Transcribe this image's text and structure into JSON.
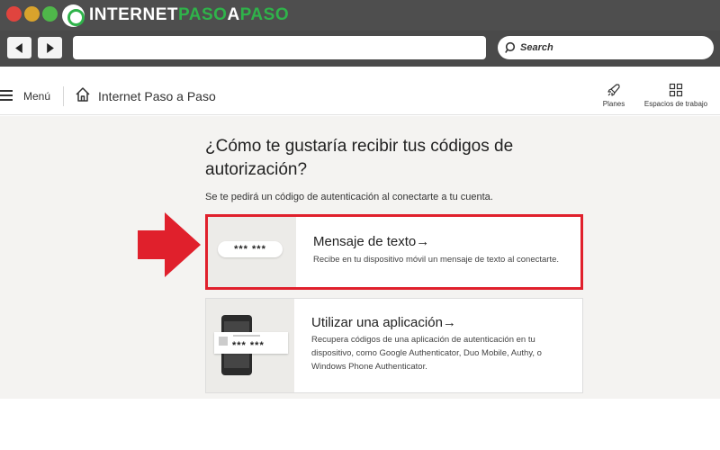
{
  "browser": {
    "logo_part1": "INTERNET",
    "logo_part2": "PASO",
    "logo_part3": "A",
    "logo_part4": "PASO",
    "search_placeholder": "Search",
    "logo_accent_color": "#2fb34a"
  },
  "header": {
    "menu_label": "Menú",
    "title": "Internet Paso a Paso",
    "actions": [
      {
        "label": "Planes",
        "icon": "rocket-icon"
      },
      {
        "label": "Espacios de trabajo",
        "icon": "grid-icon"
      }
    ]
  },
  "main": {
    "heading": "¿Cómo te gustaría recibir tus códigos de autorización?",
    "subtext": "Se te pedirá un código de autenticación al conectarte a tu cuenta.",
    "options": [
      {
        "title": "Mensaje de texto→",
        "description": "Recibe en tu dispositivo móvil un mensaje de texto al conectarte.",
        "code_mask": "*** ***",
        "highlighted": true,
        "highlight_color": "#e0202c"
      },
      {
        "title": "Utilizar una aplicación→",
        "description": "Recupera códigos de una aplicación de autenticación en tu dispositivo, como Google Authenticator, Duo Mobile, Authy, o Windows Phone Authenticator.",
        "code_mask": "*** ***",
        "highlighted": false
      }
    ]
  },
  "annotation": {
    "arrow_color": "#e0202c"
  }
}
